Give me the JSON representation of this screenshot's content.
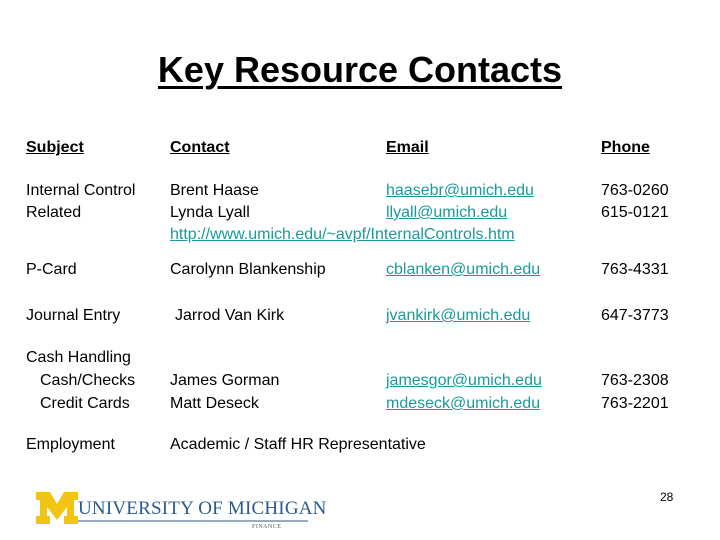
{
  "title": "Key Resource Contacts",
  "headers": {
    "subject": "Subject",
    "contact": "Contact",
    "email": "Email",
    "phone": "Phone"
  },
  "rows": {
    "internal_control": {
      "subject_line1": "Internal Control",
      "subject_line2": "Related",
      "contact1": "Brent Haase",
      "contact2": "Lynda Lyall",
      "email1": "haasebr@umich.edu",
      "email2": "llyall@umich.edu",
      "url": "http://www.umich.edu/~avpf/InternalControls.htm",
      "phone1": "763-0260",
      "phone2": "615-0121"
    },
    "pcard": {
      "subject": "P-Card",
      "contact": "Carolynn Blankenship",
      "email": "cblanken@umich.edu",
      "phone": "763-4331"
    },
    "journal_entry": {
      "subject": "Journal Entry",
      "contact": "Jarrod Van Kirk",
      "email": "jvankirk@umich.edu",
      "phone": "647-3773"
    },
    "cash_handling": {
      "subject": "Cash Handling",
      "sub1": "Cash/Checks",
      "sub2": "Credit Cards",
      "contact1": "James Gorman",
      "contact2": "Matt Deseck",
      "email1": "jamesgor@umich.edu",
      "email2": "mdeseck@umich.edu",
      "phone1": "763-2308",
      "phone2": "763-2201"
    },
    "employment": {
      "subject": "Employment",
      "contact": "Academic / Staff HR Representative"
    }
  },
  "footer": {
    "logo_text": "UNIVERSITY OF MICHIGAN",
    "logo_sub": "FINANCE",
    "page_number": "28"
  },
  "colors": {
    "link": "#1a9a9a",
    "maize": "#f2c413",
    "blue": "#2a5a8c"
  }
}
